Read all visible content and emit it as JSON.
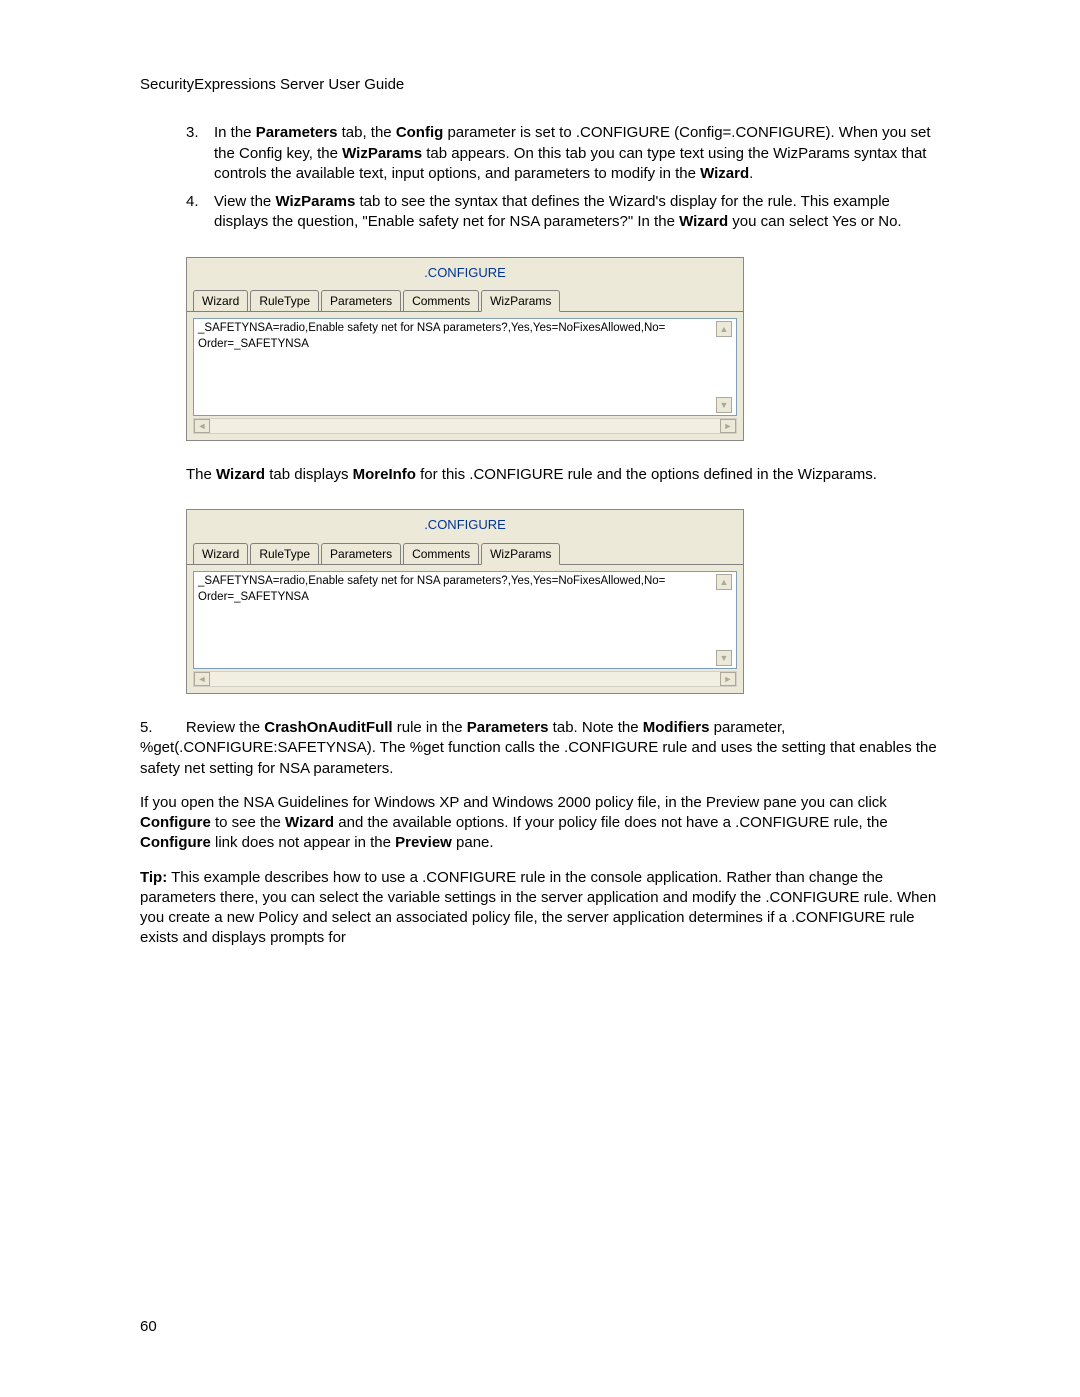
{
  "header": "SecurityExpressions Server User Guide",
  "items": {
    "n3": "3.",
    "p3_a": "In the ",
    "p3_b": "Parameters",
    "p3_c": " tab, the ",
    "p3_d": "Config",
    "p3_e": " parameter is set to .CONFIGURE (Config=.CONFIGURE). When you set the Config key, the ",
    "p3_f": "WizParams",
    "p3_g": " tab appears. On this tab you can type text using the WizParams syntax that controls the available text, input options, and parameters to modify in the ",
    "p3_h": "Wizard",
    "p3_i": ".",
    "n4": "4.",
    "p4_a": "View the ",
    "p4_b": "WizParams",
    "p4_c": " tab to see the syntax that defines the Wizard's display for the rule. This example displays the question, \"Enable safety net for NSA parameters?\" In the ",
    "p4_d": "Wizard",
    "p4_e": " you can select Yes or No."
  },
  "shot": {
    "title": ".CONFIGURE",
    "tabs": [
      "Wizard",
      "RuleType",
      "Parameters",
      "Comments",
      "WizParams"
    ],
    "activeTabIndex": 4,
    "text": "_SAFETYNSA=radio,Enable safety net for NSA parameters?,Yes,Yes=NoFixesAllowed,No=\nOrder=_SAFETYNSA"
  },
  "mid": {
    "a": "The ",
    "b": "Wizard",
    "c": " tab displays ",
    "d": "MoreInfo",
    "e": " for this .CONFIGURE rule and the options defined in the Wizparams."
  },
  "item5": {
    "n5": "5.",
    "a": "Review the ",
    "b": "CrashOnAuditFull",
    "c": " rule in the ",
    "d": "Parameters",
    "e": " tab. Note the ",
    "f": "Modifiers",
    "g": " parameter, %get(.CONFIGURE:SAFETYNSA). The %get function calls the .CONFIGURE rule and uses the setting that enables the safety net setting for NSA parameters."
  },
  "p6": {
    "a": "If you open the NSA Guidelines for Windows XP and Windows 2000 policy file, in the Preview pane you can click ",
    "b": "Configure",
    "c": " to see the ",
    "d": "Wizard",
    "e": " and the available options. If your policy file does not have a .CONFIGURE rule, the ",
    "f": "Configure",
    "g": " link does not appear in the ",
    "h": "Preview",
    "i": " pane."
  },
  "p7": {
    "a": "Tip:",
    "b": " This example describes how to use a .CONFIGURE rule in the console application. Rather than change the parameters there, you can select the variable settings in the server application and modify the .CONFIGURE rule. When you create a new Policy and select an associated policy file, the server application determines if a .CONFIGURE rule exists and displays prompts for"
  },
  "pageNumber": "60"
}
